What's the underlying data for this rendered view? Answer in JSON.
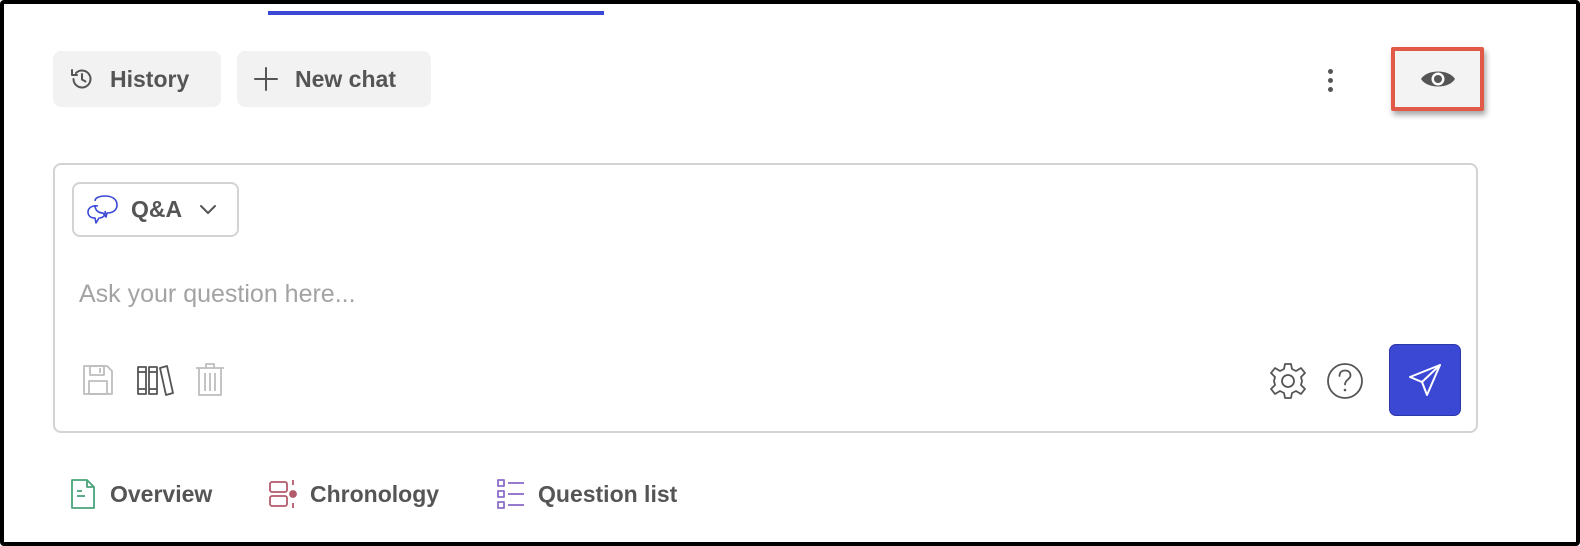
{
  "toolbar": {
    "history_label": "History",
    "new_chat_label": "New chat"
  },
  "composer": {
    "mode": {
      "selected": "Q&A",
      "icon": "chat-bubbles-icon"
    },
    "placeholder": "Ask your question here..."
  },
  "bottom_tabs": [
    {
      "label": "Overview",
      "icon": "document-icon"
    },
    {
      "label": "Chronology",
      "icon": "timeline-icon"
    },
    {
      "label": "Question list",
      "icon": "checklist-icon"
    }
  ],
  "colors": {
    "accent": "#3b48d4",
    "highlight_border": "#e05a47",
    "overview_icon": "#4aa37a",
    "chronology_icon": "#b35a6a",
    "question_list_icon": "#8a6cc9",
    "mode_icon": "#3b48d4"
  }
}
